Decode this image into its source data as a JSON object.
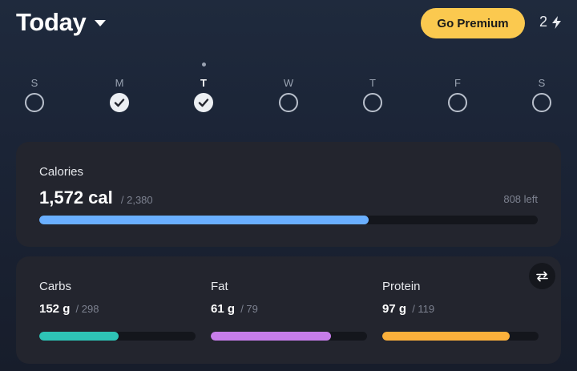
{
  "header": {
    "title": "Today",
    "premium_label": "Go Premium",
    "streak_count": "2",
    "premium_color": "#fbc94f"
  },
  "week": {
    "days": [
      {
        "label": "S",
        "done": false,
        "today": false
      },
      {
        "label": "M",
        "done": true,
        "today": false
      },
      {
        "label": "T",
        "done": true,
        "today": true
      },
      {
        "label": "W",
        "done": false,
        "today": false
      },
      {
        "label": "T",
        "done": false,
        "today": false
      },
      {
        "label": "F",
        "done": false,
        "today": false
      },
      {
        "label": "S",
        "done": false,
        "today": false
      }
    ]
  },
  "calories": {
    "label": "Calories",
    "value": "1,572 cal",
    "goal": "/ 2,380",
    "left": "808 left",
    "progress": 0.66,
    "color": "#6aafff"
  },
  "macros": [
    {
      "name": "Carbs",
      "value": "152 g",
      "goal": "/ 298",
      "progress": 0.51,
      "color": "#2ec4b6"
    },
    {
      "name": "Fat",
      "value": "61 g",
      "goal": "/ 79",
      "progress": 0.77,
      "color": "#c77dea"
    },
    {
      "name": "Protein",
      "value": "97 g",
      "goal": "/ 119",
      "progress": 0.815,
      "color": "#fbb03b"
    }
  ]
}
